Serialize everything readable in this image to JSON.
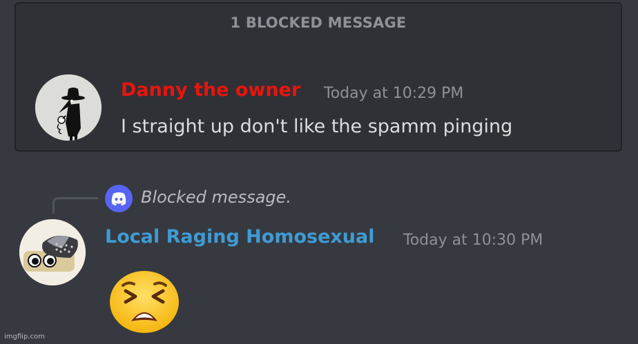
{
  "blocked": {
    "header": "1 BLOCKED MESSAGE",
    "message": {
      "username": "Danny the owner",
      "username_color": "#e8150d",
      "timestamp": "Today at 10:29 PM",
      "text": "I straight up don't like the spamm pinging"
    }
  },
  "reply": {
    "icon": "discord-logo-icon",
    "text": "Blocked message."
  },
  "message": {
    "username": "Local Raging Homosexual",
    "username_color": "#3f9bd4",
    "timestamp": "Today at 10:30 PM",
    "emoji": "tired-face-emoji"
  },
  "watermark": "imgflip.com",
  "colors": {
    "background": "#36393f",
    "blocked_background": "#2f3136",
    "muted_text": "#8e9297",
    "body_text": "#dcddde",
    "blurple": "#5865f2"
  }
}
